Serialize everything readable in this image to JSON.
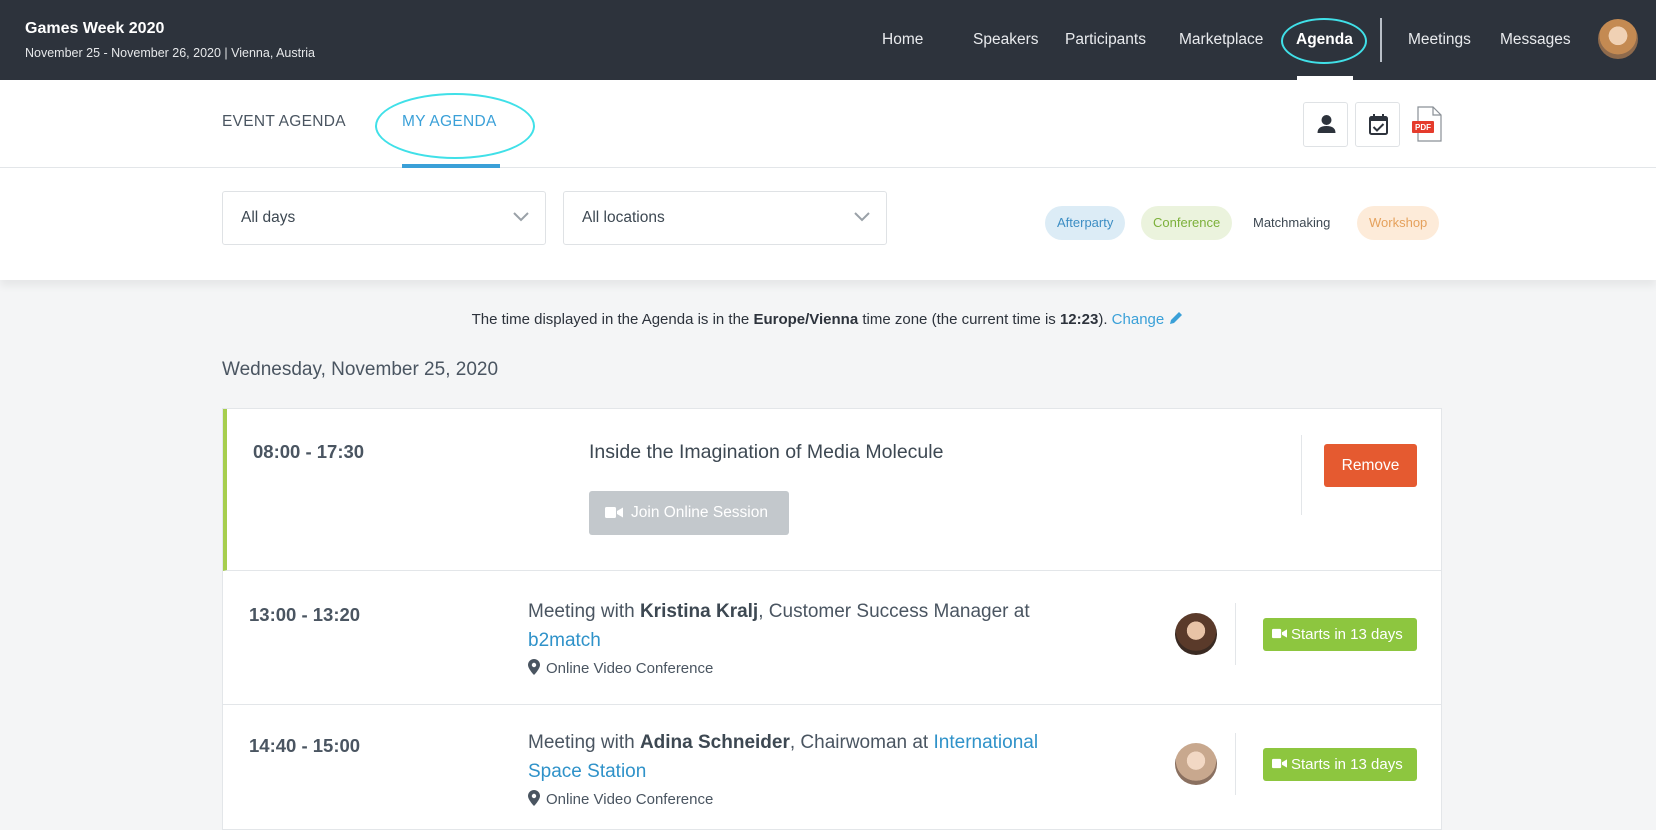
{
  "header": {
    "event_title": "Games Week 2020",
    "event_subtitle": "November 25 - November 26, 2020 | Vienna, Austria",
    "nav": [
      "Home",
      "Speakers",
      "Participants",
      "Marketplace",
      "Agenda",
      "Meetings",
      "Messages"
    ],
    "active_nav": "Agenda"
  },
  "tabs": {
    "event_agenda": "EVENT AGENDA",
    "my_agenda": "MY AGENDA",
    "active": "MY AGENDA"
  },
  "toolbar_icons": [
    "person-icon",
    "calendar-check-icon",
    "pdf-icon"
  ],
  "pdf_label": "PDF",
  "filters": {
    "days": "All days",
    "locations": "All locations",
    "categories": [
      "Afterparty",
      "Conference",
      "Matchmaking",
      "Workshop"
    ]
  },
  "timezone": {
    "prefix": "The time displayed in the Agenda is in the ",
    "zone": "Europe/Vienna",
    "middle": " time zone (the current time is ",
    "time": "12:23",
    "suffix": "). ",
    "change_label": "Change"
  },
  "day_heading": "Wednesday, November 25, 2020",
  "agenda": {
    "session": {
      "time": "08:00 - 17:30",
      "title": "Inside the Imagination of Media Molecule",
      "join_label": "Join Online Session",
      "remove_label": "Remove"
    },
    "meetings": [
      {
        "time": "13:00 - 13:20",
        "prefix": "Meeting with ",
        "person": "Kristina Kralj",
        "role": ", Customer Success Manager at ",
        "company": "b2match",
        "location": "Online Video Conference",
        "status": "Starts in 13 days"
      },
      {
        "time": "14:40 - 15:00",
        "prefix": "Meeting with ",
        "person": "Adina Schneider",
        "role": ", Chairwoman at ",
        "company": "International Space Station",
        "location": "Online Video Conference",
        "status": "Starts in 13 days"
      }
    ]
  },
  "colors": {
    "navbar": "#2d333c",
    "accent_blue": "#3aa0d8",
    "highlight_ring": "#40e0e8",
    "remove_red": "#e55a30",
    "status_green": "#8dc63f",
    "session_bar": "#a6ce4e"
  }
}
